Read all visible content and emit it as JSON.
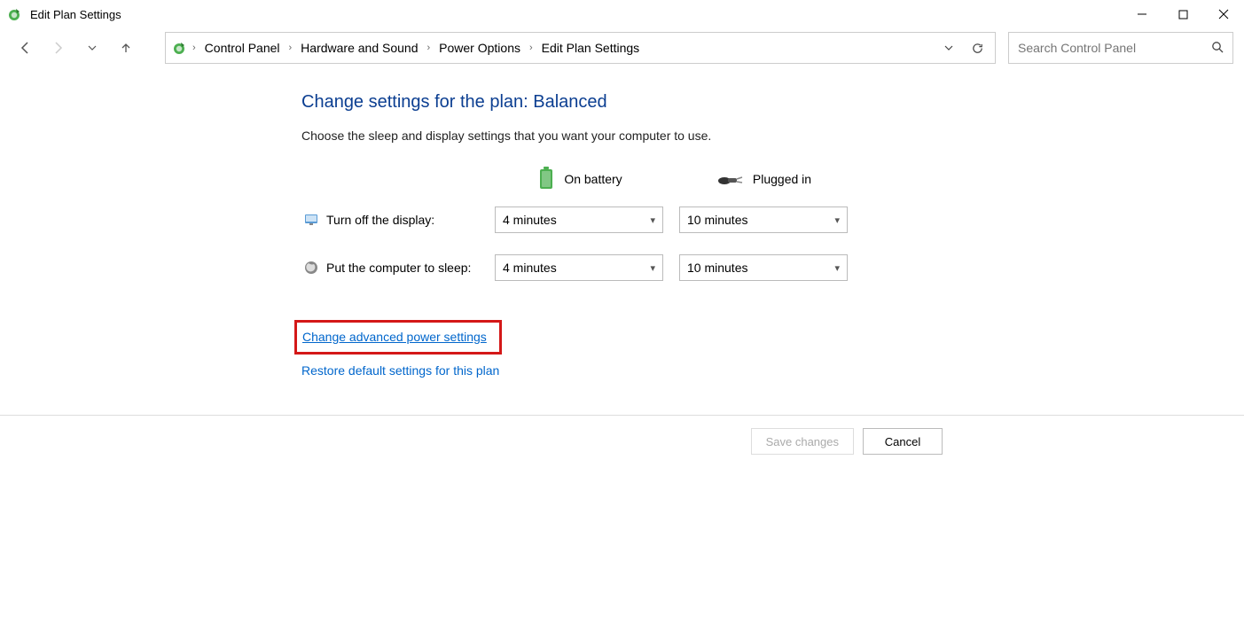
{
  "window": {
    "title": "Edit Plan Settings"
  },
  "breadcrumb": {
    "items": [
      "Control Panel",
      "Hardware and Sound",
      "Power Options",
      "Edit Plan Settings"
    ]
  },
  "search": {
    "placeholder": "Search Control Panel"
  },
  "page": {
    "heading": "Change settings for the plan: Balanced",
    "subheading": "Choose the sleep and display settings that you want your computer to use.",
    "columns": {
      "battery": "On battery",
      "plugged": "Plugged in"
    },
    "rows": {
      "display": {
        "label": "Turn off the display:",
        "battery_value": "4 minutes",
        "plugged_value": "10 minutes"
      },
      "sleep": {
        "label": "Put the computer to sleep:",
        "battery_value": "4 minutes",
        "plugged_value": "10 minutes"
      }
    },
    "links": {
      "advanced": "Change advanced power settings",
      "restore": "Restore default settings for this plan"
    }
  },
  "footer": {
    "save": "Save changes",
    "cancel": "Cancel"
  }
}
